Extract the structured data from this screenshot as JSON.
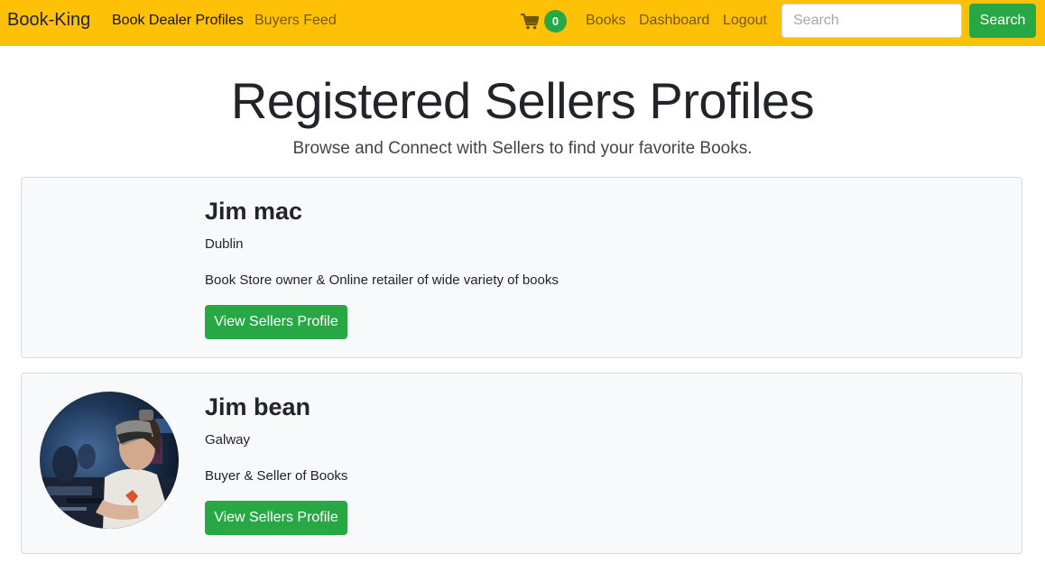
{
  "navbar": {
    "brand": "Book-King",
    "links": [
      "Book Dealer Profiles",
      "Buyers Feed"
    ],
    "cart_count": "0",
    "right_links": [
      "Books",
      "Dashboard",
      "Logout"
    ],
    "search_placeholder": "Search",
    "search_value": "",
    "search_button": "Search",
    "background_color": "#ffc107",
    "accent_color": "#28a745"
  },
  "header": {
    "title": "Registered Sellers Profiles",
    "subtitle": "Browse and Connect with Sellers to find your favorite Books."
  },
  "sellers": [
    {
      "name": "Jim mac",
      "location": "Dublin",
      "description": "Book Store owner & Online retailer of wide variety of books",
      "button_label": "View Sellers Profile",
      "has_avatar": false
    },
    {
      "name": "Jim bean",
      "location": "Galway",
      "description": "Buyer & Seller of Books",
      "button_label": "View Sellers Profile",
      "has_avatar": true
    }
  ]
}
